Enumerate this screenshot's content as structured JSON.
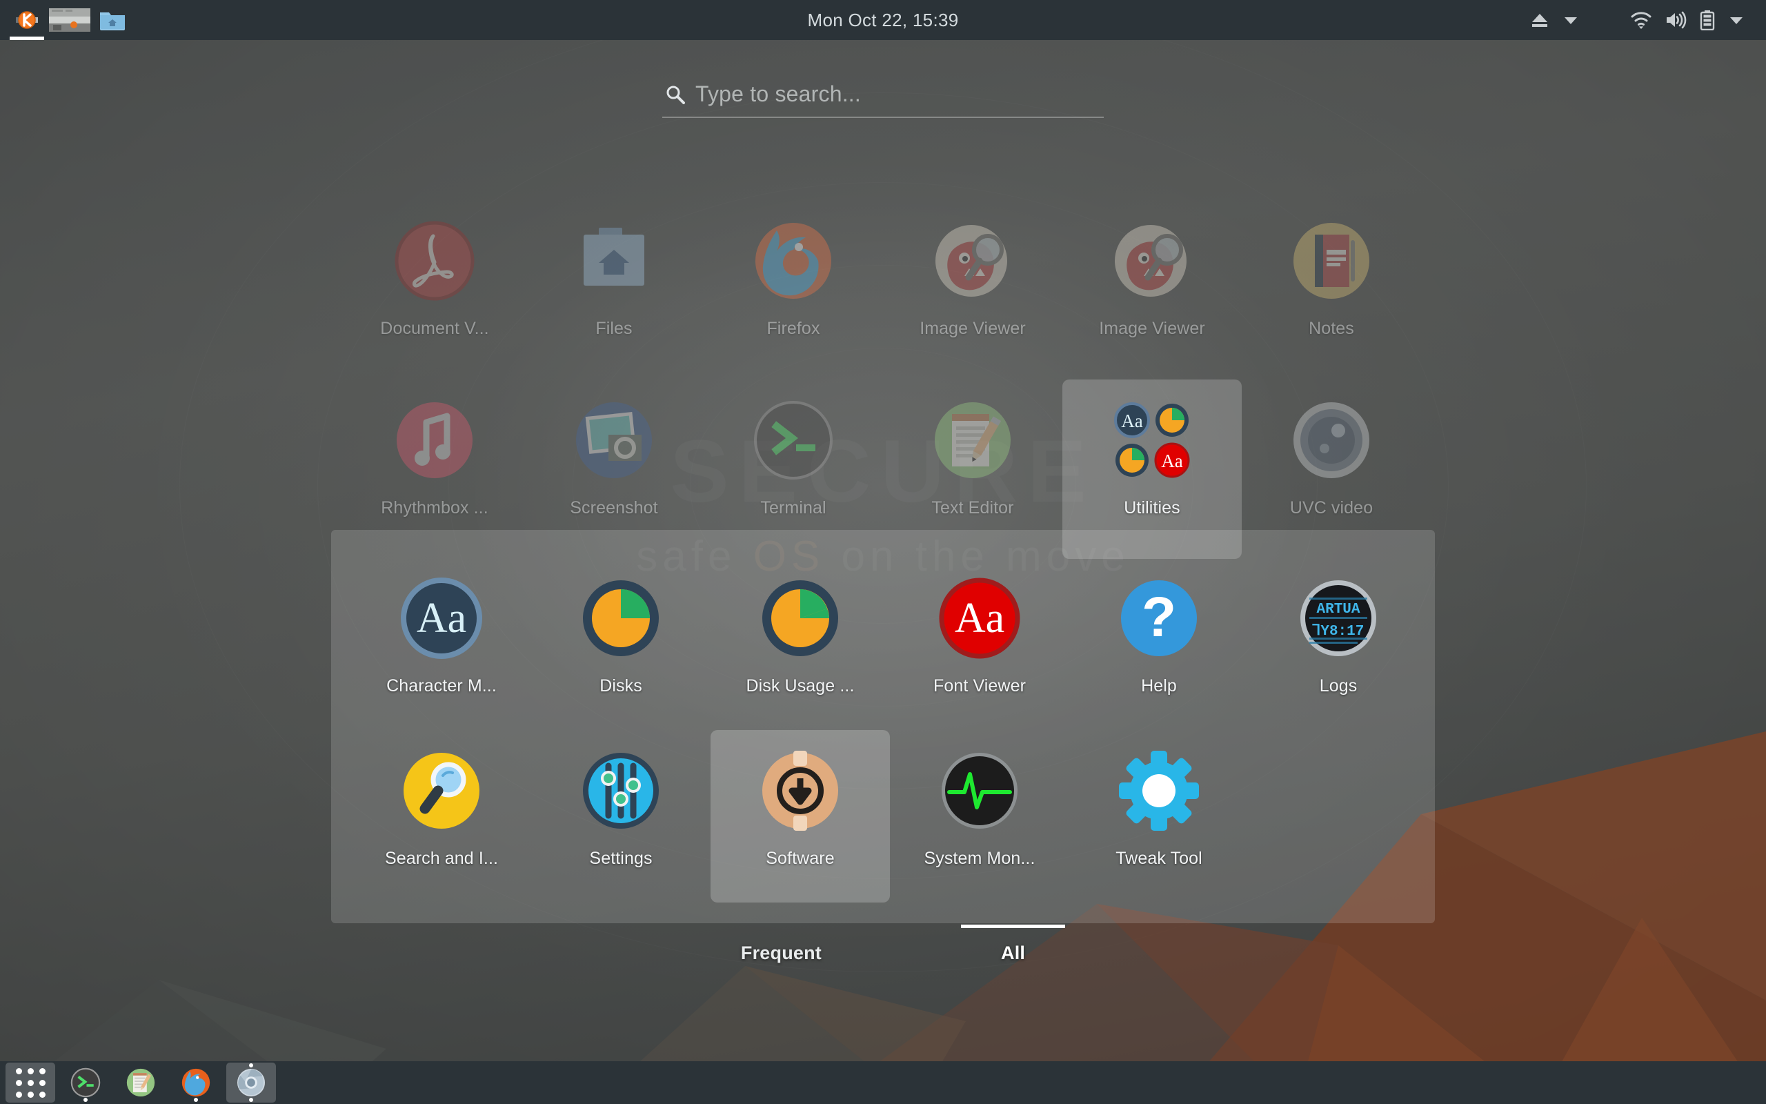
{
  "topbar": {
    "clock": "Mon Oct 22, 15:39",
    "windows": [
      {
        "name": "window-button-krita",
        "label": "",
        "active": true
      },
      {
        "name": "window-button-image",
        "label": "",
        "active": false
      },
      {
        "name": "window-button-files",
        "label": "",
        "active": false
      }
    ],
    "status_icons": [
      {
        "name": "eject-icon",
        "glyph": "eject"
      },
      {
        "name": "chevron-down-icon",
        "glyph": "chevron"
      },
      {
        "name": "wifi-icon",
        "glyph": "wifi"
      },
      {
        "name": "volume-icon",
        "glyph": "volume"
      },
      {
        "name": "battery-icon",
        "glyph": "battery"
      },
      {
        "name": "chevron-down-icon-2",
        "glyph": "chevron"
      }
    ]
  },
  "search": {
    "placeholder": "Type to search...",
    "value": "",
    "icon": "search-icon"
  },
  "wallpaper": {
    "watermark_main": "SECURE",
    "watermark_sub_a": "safe ",
    "watermark_sub_b": "OS",
    "watermark_sub_c": " on the move"
  },
  "appgrid": {
    "rows": [
      [
        {
          "label": "Document V...",
          "icon": "document-viewer-icon",
          "state": "dimmed"
        },
        {
          "label": "Files",
          "icon": "files-icon",
          "state": "dimmed"
        },
        {
          "label": "Firefox",
          "icon": "firefox-icon",
          "state": "dimmed"
        },
        {
          "label": "Image Viewer",
          "icon": "image-viewer-icon",
          "state": "dimmed"
        },
        {
          "label": "Image Viewer",
          "icon": "image-viewer-icon",
          "state": "dimmed"
        },
        {
          "label": "Notes",
          "icon": "notes-icon",
          "state": "dimmed"
        }
      ],
      [
        {
          "label": "Rhythmbox ...",
          "icon": "rhythmbox-icon",
          "state": "dimmed"
        },
        {
          "label": "Screenshot",
          "icon": "screenshot-icon",
          "state": "dimmed"
        },
        {
          "label": "Terminal",
          "icon": "terminal-icon",
          "state": "dimmed"
        },
        {
          "label": "Text Editor",
          "icon": "text-editor-icon",
          "state": "dimmed"
        },
        {
          "label": "Utilities",
          "icon": "utilities-folder-icon",
          "state": "folder-open"
        },
        {
          "label": "UVC video",
          "icon": "uvc-video-icon",
          "state": "dimmed"
        }
      ]
    ]
  },
  "folder_popup": {
    "name": "Utilities",
    "rows": [
      [
        {
          "label": "Character M...",
          "icon": "character-map-icon",
          "state": ""
        },
        {
          "label": "Disks",
          "icon": "disks-icon",
          "state": ""
        },
        {
          "label": "Disk Usage ...",
          "icon": "disk-usage-icon",
          "state": ""
        },
        {
          "label": "Font Viewer",
          "icon": "font-viewer-icon",
          "state": ""
        },
        {
          "label": "Help",
          "icon": "help-icon",
          "state": ""
        },
        {
          "label": "Logs",
          "icon": "logs-icon",
          "state": ""
        }
      ],
      [
        {
          "label": "Search and I...",
          "icon": "search-and-index-icon",
          "state": ""
        },
        {
          "label": "Settings",
          "icon": "settings-icon",
          "state": ""
        },
        {
          "label": "Software",
          "icon": "software-icon",
          "state": "selected"
        },
        {
          "label": "System Mon...",
          "icon": "system-monitor-icon",
          "state": ""
        },
        {
          "label": "Tweak Tool",
          "icon": "tweak-tool-icon",
          "state": ""
        }
      ]
    ]
  },
  "view_tabs": [
    {
      "label": "Frequent",
      "active": false,
      "name": "tab-frequent"
    },
    {
      "label": "All",
      "active": true,
      "name": "tab-all"
    }
  ],
  "dock": {
    "items": [
      {
        "name": "show-applications-button",
        "icon": "apps-grid-icon",
        "highlighted": true,
        "running": false,
        "above_dot": false
      },
      {
        "name": "dock-item-terminal",
        "icon": "terminal-icon",
        "highlighted": false,
        "running": true,
        "above_dot": false
      },
      {
        "name": "dock-item-text-editor",
        "icon": "text-editor-icon",
        "highlighted": false,
        "running": false,
        "above_dot": false
      },
      {
        "name": "dock-item-firefox",
        "icon": "firefox-icon",
        "highlighted": false,
        "running": true,
        "above_dot": false
      },
      {
        "name": "dock-item-chromium",
        "icon": "chromium-icon",
        "highlighted": true,
        "running": true,
        "above_dot": true
      }
    ]
  },
  "colors": {
    "panel": "#2b3338",
    "panel_text": "#d4dbde",
    "accent_orange": "#f5a623",
    "accent_green": "#27ae60",
    "accent_red": "#e00000",
    "accent_blue": "#3498db",
    "dark_slate": "#2e4356"
  }
}
